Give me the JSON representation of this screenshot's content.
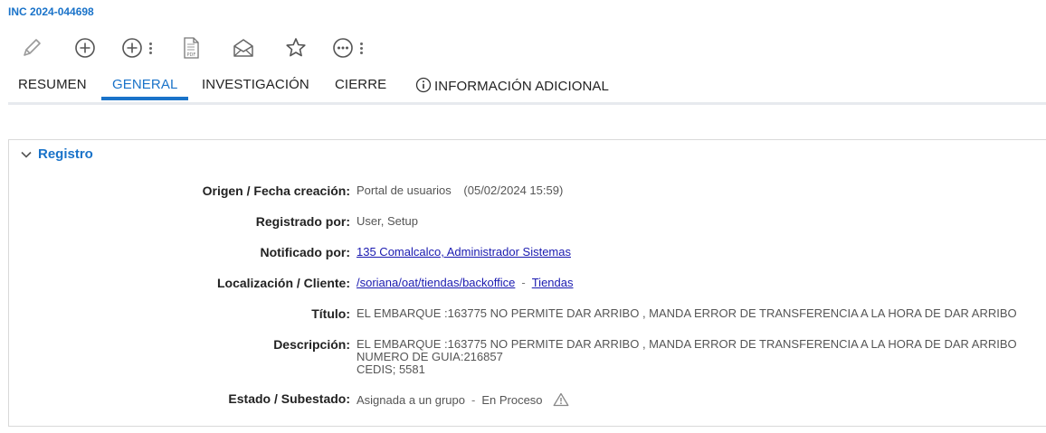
{
  "incident": {
    "id": "INC 2024-044698"
  },
  "toolbar": {
    "edit": "pencil-icon",
    "add": "plus-circle-icon",
    "add_more": "plus-circle-menu-icon",
    "pdf": "pdf-icon",
    "mail": "envelope-icon",
    "favorite": "star-icon",
    "more": "more-icon"
  },
  "tabs": [
    {
      "label": "RESUMEN"
    },
    {
      "label": "GENERAL"
    },
    {
      "label": "INVESTIGACIÓN"
    },
    {
      "label": "CIERRE"
    },
    {
      "label": "INFORMACIÓN ADICIONAL"
    }
  ],
  "active_tab": "GENERAL",
  "section": {
    "title": "Registro"
  },
  "fields": {
    "origin": {
      "label": "Origen / Fecha creación:",
      "value": "Portal de usuarios",
      "date": "(05/02/2024 15:59)"
    },
    "registered_by": {
      "label": "Registrado por:",
      "value": "User, Setup"
    },
    "notified_by": {
      "label": "Notificado por:",
      "value": "135 Comalcalco, Administrador Sistemas"
    },
    "location": {
      "label": "Localización / Cliente:",
      "location": "/soriana/oat/tiendas/backoffice",
      "separator": "-",
      "client": "Tiendas"
    },
    "title": {
      "label": "Título:",
      "value": "EL EMBARQUE :163775 NO PERMITE DAR ARRIBO , MANDA ERROR DE TRANSFERENCIA A LA HORA DE DAR ARRIBO"
    },
    "description": {
      "label": "Descripción:",
      "lines": [
        "EL EMBARQUE :163775 NO PERMITE DAR ARRIBO , MANDA ERROR DE  TRANSFERENCIA A LA HORA DE DAR ARRIBO",
        "NUMERO DE GUIA:216857",
        "CEDIS; 5581"
      ]
    },
    "status": {
      "label": "Estado / Subestado:",
      "state": "Asignada a un grupo",
      "separator": "-",
      "substate": "En Proceso"
    }
  },
  "colors": {
    "accent": "#1a73c9",
    "link": "#1a1ab0",
    "warning_icon": "#888888"
  }
}
